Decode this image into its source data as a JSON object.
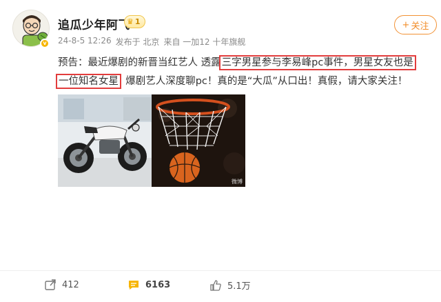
{
  "author": {
    "name": "追瓜少年阿飞",
    "level": "1",
    "verified_mark": "v"
  },
  "meta": {
    "time": "24-8-5 12:26",
    "location": "发布于 北京",
    "source": "来自 一加12 十年旗舰"
  },
  "follow_button": {
    "icon": "+",
    "label": "关注"
  },
  "post": {
    "text_part1": "预告：最近爆剧的新晋当红艺人 透露",
    "text_highlight1": "三字男星参与李易峰pc事件，男星女友也是",
    "text_highlight2": "一位知名女星",
    "text_part2": "  爆剧艺人深度聊pc！真的是“大瓜”从口出！真假，请大家关注！"
  },
  "images": [
    {
      "name": "motorcycle-photo"
    },
    {
      "name": "basketball-photo"
    }
  ],
  "image_watermark": "微博",
  "actions": {
    "repost_count": "412",
    "comment_count": "6163",
    "like_count": "5.1万"
  },
  "colors": {
    "highlight_box": "#e23c3c",
    "follow_accent": "#f28c28",
    "comment_icon": "#f7b500"
  }
}
